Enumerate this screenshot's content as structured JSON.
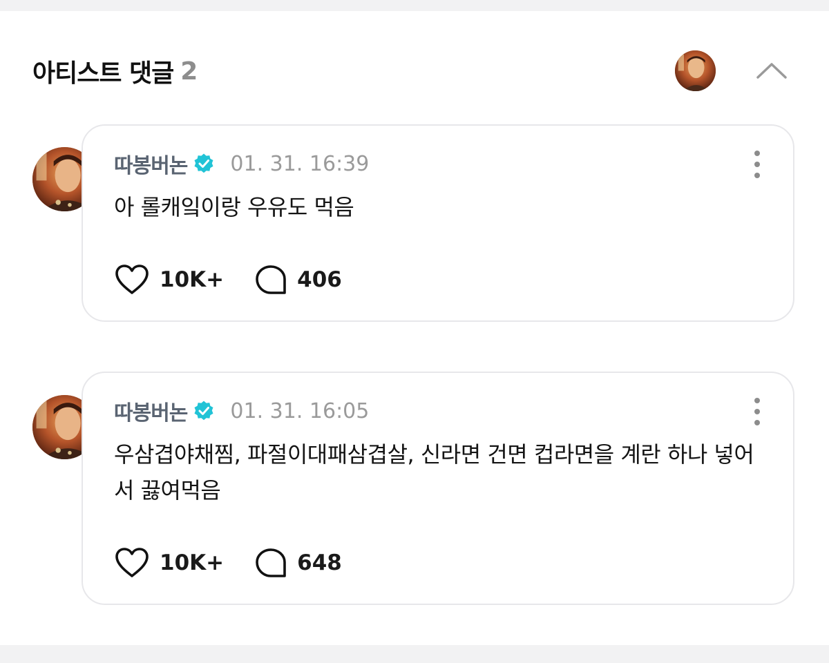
{
  "header": {
    "title": "아티스트 댓글",
    "count": "2"
  },
  "comments": [
    {
      "author": "따봉버논",
      "verified": true,
      "timestamp": "01. 31. 16:39",
      "text": "아 롤캐잌이랑 우유도 먹음",
      "likes": "10K+",
      "replies": "406"
    },
    {
      "author": "따봉버논",
      "verified": true,
      "timestamp": "01. 31. 16:05",
      "text": "우삼겹야채찜, 파절이대패삼겹살, 신라면 건면 컵라면을 계란 하나 넣어서 끓여먹음",
      "likes": "10K+",
      "replies": "648"
    }
  ],
  "colors": {
    "verified_badge": "#21c3d6",
    "author": "#5a6472",
    "timestamp": "#9a9a9a",
    "count": "#8d8d8d",
    "card_border": "#e7e7ea"
  },
  "icons": {
    "collapse": "chevron-up-icon",
    "like": "heart-icon",
    "reply": "speech-bubble-icon",
    "more": "more-vertical-icon",
    "verified": "verified-badge-icon"
  }
}
